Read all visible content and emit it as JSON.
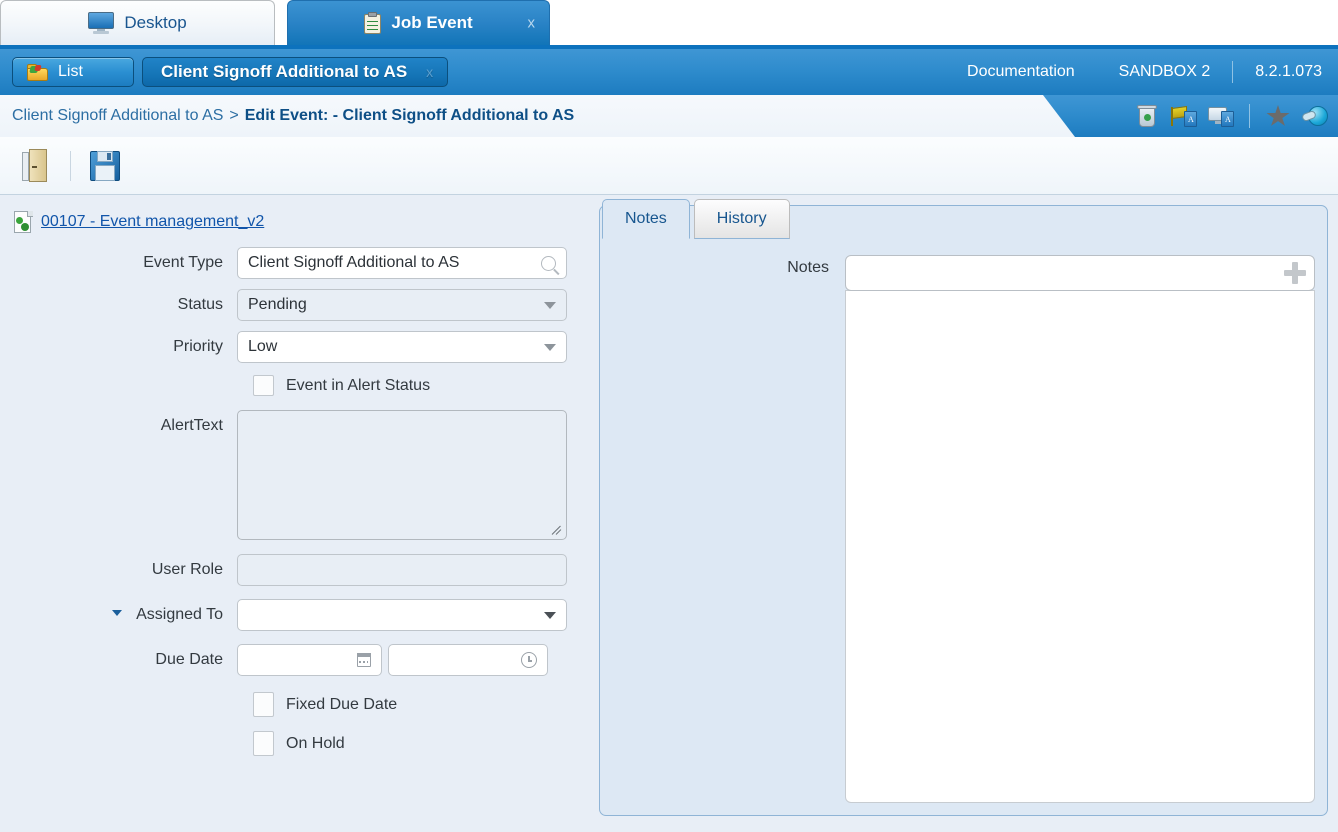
{
  "window_tabs": [
    {
      "label": "Desktop",
      "icon": "monitor-icon",
      "active": false,
      "closable": false
    },
    {
      "label": "Job Event",
      "icon": "clipboard-icon",
      "active": true,
      "closable": true,
      "close_label": "x"
    }
  ],
  "appbar": {
    "list_button": "List",
    "title_pill": "Client Signoff Additional to AS",
    "title_close": "x",
    "documentation": "Documentation",
    "environment": "SANDBOX 2",
    "version": "8.2.1.073",
    "icons": [
      "recycle-bin-icon",
      "flag-document-icon",
      "screen-document-icon",
      "favorite-star-icon",
      "globe-key-icon"
    ]
  },
  "breadcrumb": {
    "parent": "Client Signoff Additional to AS",
    "separator": ">",
    "current": "Edit Event: - Client Signoff Additional to AS"
  },
  "toolbar": {
    "exit_label": "Exit",
    "save_label": "Save"
  },
  "record_link": {
    "text": "00107 - Event management_v2",
    "icon": "record-document-icon"
  },
  "form": {
    "event_type": {
      "label": "Event Type",
      "value": "Client Signoff Additional to AS",
      "icon": "search-icon"
    },
    "status": {
      "label": "Status",
      "value": "Pending",
      "disabled": true
    },
    "priority": {
      "label": "Priority",
      "value": "Low",
      "disabled": false
    },
    "event_in_alert_status": {
      "label": "Event in Alert Status",
      "checked": false
    },
    "alert_text": {
      "label": "AlertText",
      "value": ""
    },
    "user_role": {
      "label": "User Role",
      "value": ""
    },
    "assigned_to": {
      "label": "Assigned To",
      "value": ""
    },
    "due_date": {
      "label": "Due Date",
      "date_value": "",
      "time_value": ""
    },
    "fixed_due_date": {
      "label": "Fixed Due Date",
      "checked": false
    },
    "on_hold": {
      "label": "On Hold",
      "checked": false
    }
  },
  "right_panel": {
    "tabs": [
      {
        "label": "Notes",
        "active": true
      },
      {
        "label": "History",
        "active": false
      }
    ],
    "notes": {
      "label": "Notes",
      "input_value": "",
      "body_value": "",
      "add_icon": "plus-icon"
    }
  },
  "colors": {
    "app_blue": "#2f8ccd",
    "accent_dark_blue": "#0d68a9",
    "panel_bg": "#dde8f4",
    "page_bg": "#e8eef6",
    "link": "#1155aa"
  }
}
